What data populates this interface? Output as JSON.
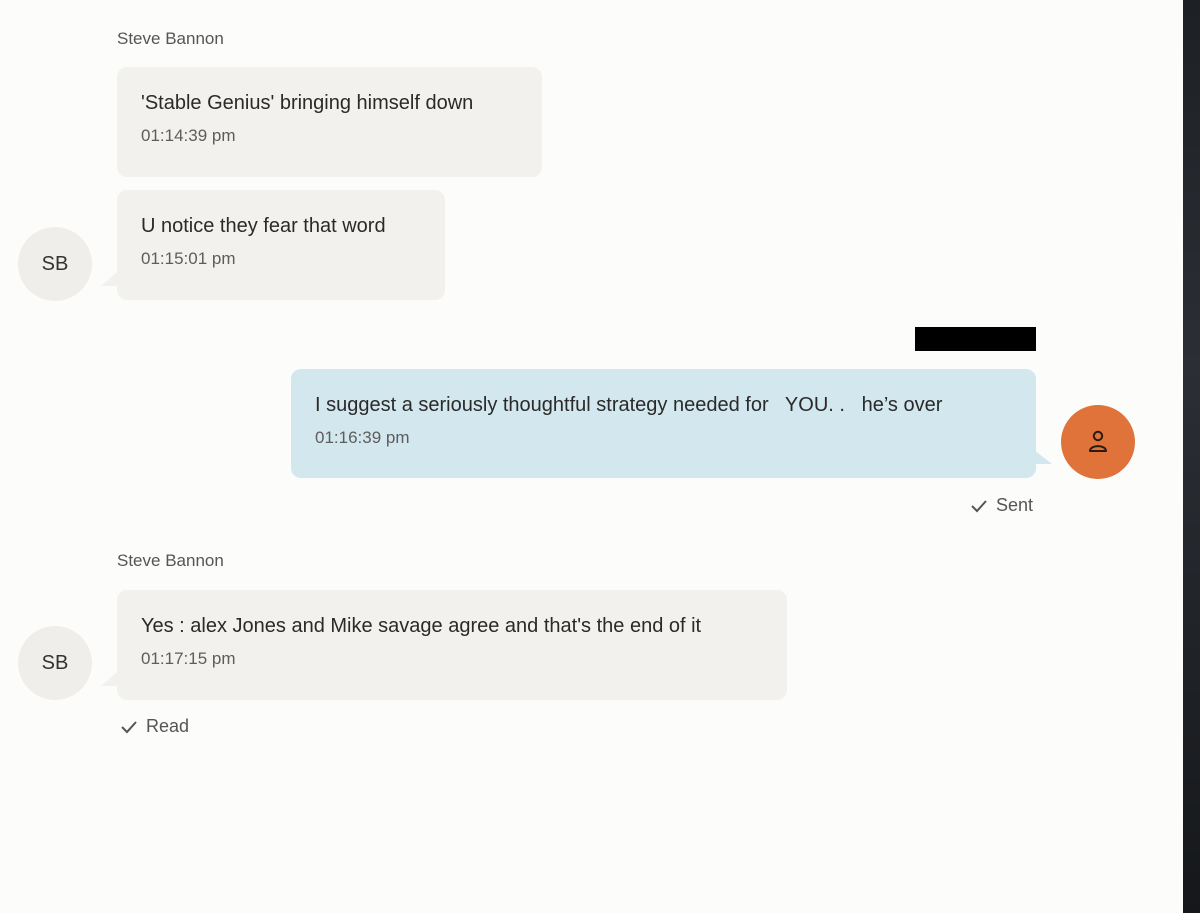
{
  "conversation": {
    "block1": {
      "sender": "Steve Bannon",
      "avatar_initials": "SB",
      "messages": [
        {
          "text": "'Stable Genius' bringing himself down",
          "time": "01:14:39 pm"
        },
        {
          "text": "U notice they fear that word",
          "time": "01:15:01 pm"
        }
      ]
    },
    "outgoing": {
      "text": "I suggest a seriously thoughtful strategy needed for   YOU. .   he’s over",
      "time": "01:16:39 pm",
      "status": "Sent",
      "avatar_icon": "person-icon"
    },
    "block2": {
      "sender": "Steve Bannon",
      "avatar_initials": "SB",
      "messages": [
        {
          "text": "Yes : alex Jones and Mike savage agree and that's the end of it",
          "time": "01:17:15 pm"
        }
      ],
      "status": "Read"
    }
  },
  "colors": {
    "incoming_bubble": "#f2f1ee",
    "outgoing_bubble": "#d3e7ee",
    "user_avatar": "#e0733a"
  }
}
